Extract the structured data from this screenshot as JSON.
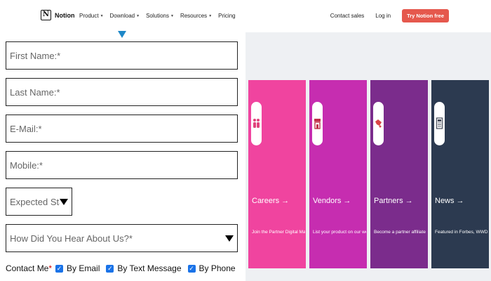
{
  "nav": {
    "brand": "Notion",
    "menu": [
      "Product",
      "Download",
      "Solutions",
      "Resources",
      "Pricing"
    ],
    "contact_sales": "Contact sales",
    "login": "Log in",
    "cta": "Try Notion free"
  },
  "form": {
    "first_name": "First Name:*",
    "last_name": "Last Name:*",
    "email": "E-Mail:*",
    "mobile": "Mobile:*",
    "start": "Expected Start Y",
    "source": "How Did You Hear About Us?*",
    "contact_label": "Contact Me",
    "contact_required": "*",
    "options": [
      "By Email",
      "By Text Message",
      "By Phone"
    ]
  },
  "cards": [
    {
      "title": "Careers →",
      "description": "Join the Partner Digital Marketing team in Austin",
      "color": "#f0449f",
      "icon": "people-icon",
      "icon_color": "#e0437c"
    },
    {
      "title": "Vendors →",
      "description": "List your product on our website",
      "color": "#c62db0",
      "icon": "store-icon",
      "icon_color": "#c0314a"
    },
    {
      "title": "Partners →",
      "description": "Become a partner affiliate",
      "color": "#7b2c8c",
      "icon": "handshake-icon",
      "icon_color": "#d94545"
    },
    {
      "title": "News →",
      "description": "Featured in Forbes, WWD, MSN, and more",
      "color": "#2c3a50",
      "icon": "newspaper-icon",
      "icon_color": "#444a57"
    }
  ]
}
